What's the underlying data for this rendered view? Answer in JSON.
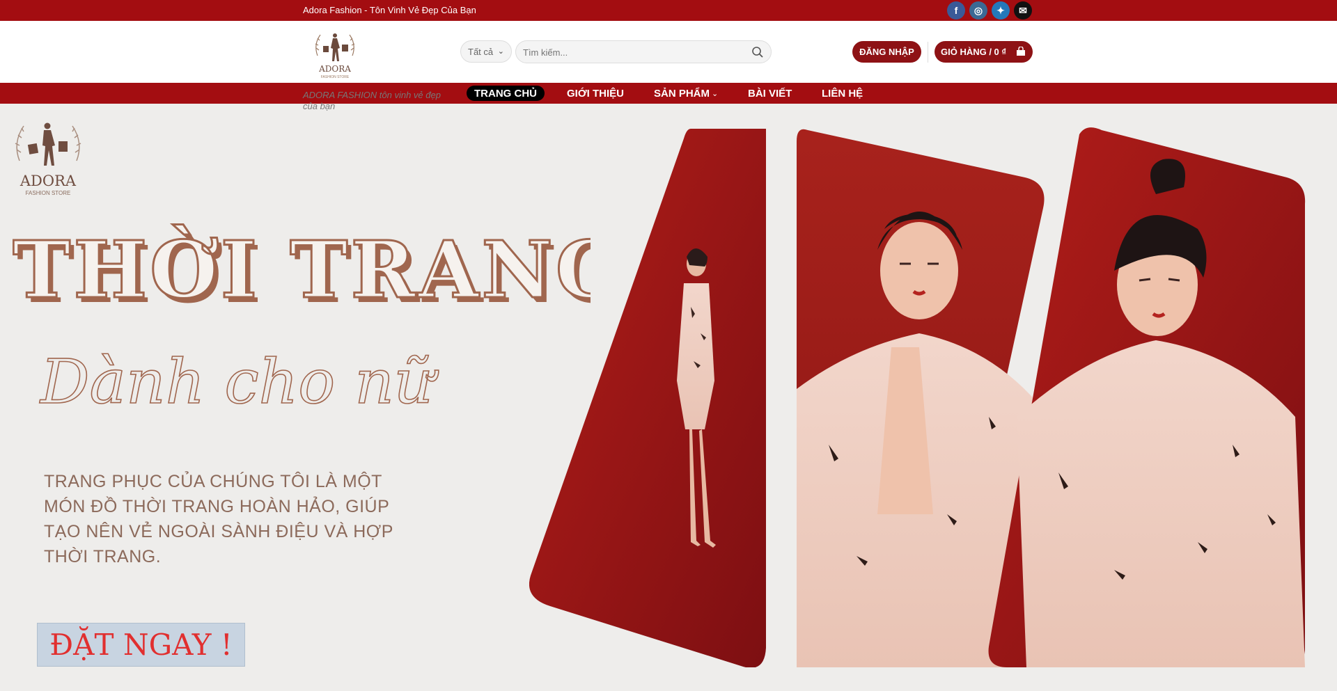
{
  "topbar": {
    "tagline": "Adora Fashion - Tôn Vinh Vẻ Đẹp Của Bạn",
    "social": [
      {
        "name": "facebook-icon",
        "glyph": "f"
      },
      {
        "name": "instagram-icon",
        "glyph": "◎"
      },
      {
        "name": "twitter-icon",
        "glyph": "✦"
      },
      {
        "name": "email-icon",
        "glyph": "✉"
      }
    ]
  },
  "header": {
    "logo": {
      "brand": "ADORA",
      "sub": "FASHION STORE"
    },
    "category_select": {
      "value": "Tất cả"
    },
    "search": {
      "placeholder": "Tìm kiếm..."
    },
    "login_label": "ĐĂNG NHẬP",
    "cart_label": "GIỎ HÀNG / 0 ₫"
  },
  "nav": {
    "slogan": "ADORA FASHION tôn vinh vẻ đẹp của bạn",
    "items": [
      {
        "label": "TRANG CHỦ",
        "active": true
      },
      {
        "label": "GIỚI THIỆU",
        "active": false
      },
      {
        "label": "SẢN PHẨM",
        "active": false,
        "dropdown": true
      },
      {
        "label": "BÀI VIẾT",
        "active": false
      },
      {
        "label": "LIÊN HỆ",
        "active": false
      }
    ]
  },
  "hero": {
    "logo": {
      "brand": "ADORA",
      "sub": "FASHION STORE"
    },
    "headline": "THỜI TRANG",
    "script_line": "Dành cho nữ",
    "description": "TRANG PHỤC CỦA CHÚNG TÔI LÀ MỘT MÓN ĐỒ THỜI TRANG HOÀN HẢO, GIÚP TẠO NÊN VẺ NGOÀI SÀNH ĐIỆU VÀ HỢP THỜI TRANG.",
    "cta_label": "ĐẶT NGAY !"
  },
  "colors": {
    "brand_red": "#a30d11",
    "button_red": "#8e1215",
    "headline_brown": "#a0664e",
    "hero_bg": "#eeedeb"
  }
}
